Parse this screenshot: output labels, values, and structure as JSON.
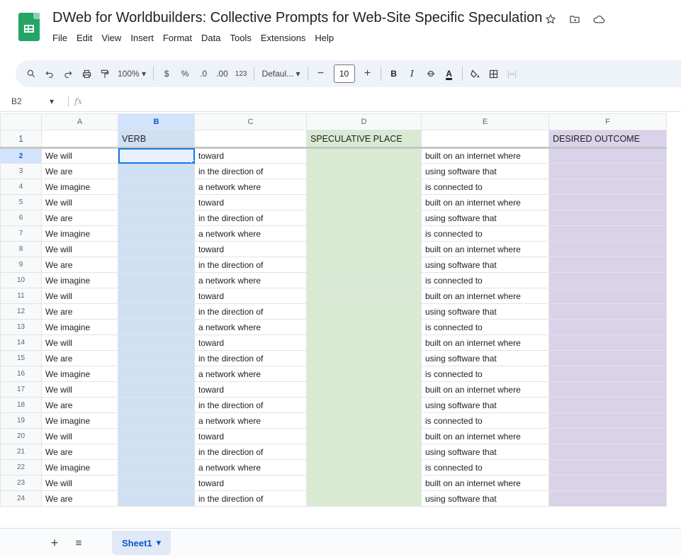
{
  "title": "DWeb for Worldbuilders: Collective Prompts for Web-Site Specific Speculation",
  "menu": [
    "File",
    "Edit",
    "View",
    "Insert",
    "Format",
    "Data",
    "Tools",
    "Extensions",
    "Help"
  ],
  "toolbar": {
    "zoom": "100%",
    "currency": "$",
    "percent": "%",
    "decrease_decimal": ".0",
    "increase_decimal": ".00",
    "number_format": "123",
    "font": "Defaul...",
    "font_size": "10",
    "bold": "B",
    "italic": "I"
  },
  "formula_bar": {
    "cell_ref": "B2",
    "fx": "fx",
    "value": ""
  },
  "columns": [
    "A",
    "B",
    "C",
    "D",
    "E",
    "F"
  ],
  "selected_column": "B",
  "header_row": {
    "row": "1",
    "A": "",
    "B": "VERB",
    "C": "",
    "D": "SPECULATIVE PLACE",
    "E": "",
    "F": "DESIRED OUTCOME"
  },
  "rows": [
    {
      "n": "2",
      "A": "We will",
      "C": "toward",
      "E": "built on an internet where"
    },
    {
      "n": "3",
      "A": "We are",
      "C": "in the direction of",
      "E": "using software that"
    },
    {
      "n": "4",
      "A": "We imagine",
      "C": "a network where",
      "E": "is connected to"
    },
    {
      "n": "5",
      "A": "We will",
      "C": "toward",
      "E": "built on an internet where"
    },
    {
      "n": "6",
      "A": "We are",
      "C": "in the direction of",
      "E": "using software that"
    },
    {
      "n": "7",
      "A": "We imagine",
      "C": "a network where",
      "E": "is connected to"
    },
    {
      "n": "8",
      "A": "We will",
      "C": "toward",
      "E": "built on an internet where"
    },
    {
      "n": "9",
      "A": "We are",
      "C": "in the direction of",
      "E": "using software that"
    },
    {
      "n": "10",
      "A": "We imagine",
      "C": "a network where",
      "E": "is connected to"
    },
    {
      "n": "11",
      "A": "We will",
      "C": "toward",
      "E": "built on an internet where"
    },
    {
      "n": "12",
      "A": "We are",
      "C": "in the direction of",
      "E": "using software that"
    },
    {
      "n": "13",
      "A": "We imagine",
      "C": "a network where",
      "E": "is connected to"
    },
    {
      "n": "14",
      "A": "We will",
      "C": "toward",
      "E": "built on an internet where"
    },
    {
      "n": "15",
      "A": "We are",
      "C": "in the direction of",
      "E": "using software that"
    },
    {
      "n": "16",
      "A": "We imagine",
      "C": "a network where",
      "E": "is connected to"
    },
    {
      "n": "17",
      "A": "We will",
      "C": "toward",
      "E": "built on an internet where"
    },
    {
      "n": "18",
      "A": "We are",
      "C": "in the direction of",
      "E": "using software that"
    },
    {
      "n": "19",
      "A": "We imagine",
      "C": "a network where",
      "E": "is connected to"
    },
    {
      "n": "20",
      "A": "We will",
      "C": "toward",
      "E": "built on an internet where"
    },
    {
      "n": "21",
      "A": "We are",
      "C": "in the direction of",
      "E": "using software that"
    },
    {
      "n": "22",
      "A": "We imagine",
      "C": "a network where",
      "E": "is connected to"
    },
    {
      "n": "23",
      "A": "We will",
      "C": "toward",
      "E": "built on an internet where"
    },
    {
      "n": "24",
      "A": "We are",
      "C": "in the direction of",
      "E": "using software that"
    }
  ],
  "sheet_tabs": [
    "Sheet1"
  ],
  "colors": {
    "column_b": "#cfe0f3",
    "column_d": "#d9ead3",
    "column_f": "#d9d2e9",
    "selection": "#1a73e8",
    "logo": "#23a566"
  }
}
